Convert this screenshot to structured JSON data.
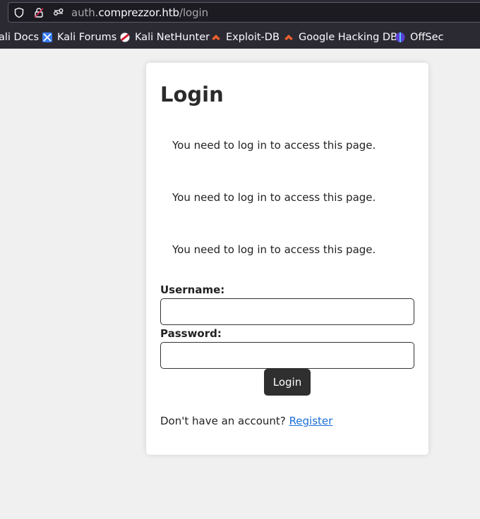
{
  "browser": {
    "url_prefix": "auth.",
    "url_domain": "comprezzor.htb",
    "url_path": "/login",
    "bookmarks": [
      {
        "label": "ali Docs",
        "icon": "kali-docs-icon"
      },
      {
        "label": "Kali Forums",
        "icon": "kali-forums-icon"
      },
      {
        "label": "Kali NetHunter",
        "icon": "kali-nethunter-icon"
      },
      {
        "label": "Exploit-DB",
        "icon": "exploit-db-icon"
      },
      {
        "label": "Google Hacking DB",
        "icon": "ghdb-icon"
      },
      {
        "label": "OffSec",
        "icon": "offsec-icon"
      }
    ]
  },
  "login": {
    "title": "Login",
    "messages": [
      "You need to log in to access this page.",
      "You need to log in to access this page.",
      "You need to log in to access this page."
    ],
    "username_label": "Username:",
    "username_value": "",
    "password_label": "Password:",
    "password_value": "",
    "submit_label": "Login",
    "register_prompt": "Don't have an account?",
    "register_link": "Register"
  }
}
